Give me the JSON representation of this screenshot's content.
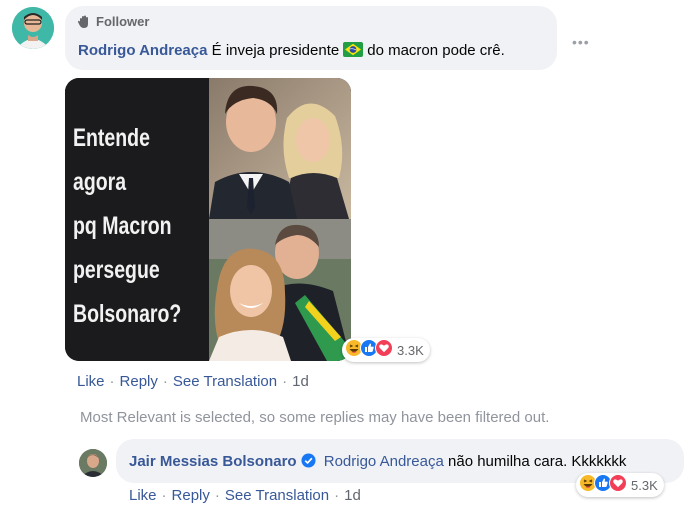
{
  "comment": {
    "badge": "Follower",
    "author": "Rodrigo Andreaça",
    "text_before_flag": "É inveja presidente",
    "text_after_flag": "do macron pode crê.",
    "more_label": "•••",
    "reaction_count": "3.3K",
    "actions": {
      "like": "Like",
      "reply": "Reply",
      "translate": "See Translation",
      "time": "1d"
    }
  },
  "attachment": {
    "meme_text": "Entende\nagora\npq Macron\npersegue\nBolsonaro?"
  },
  "filter_note": "Most Relevant is selected, so some replies may have been filtered out.",
  "reply": {
    "author": "Jair Messias Bolsonaro",
    "mention": "Rodrigo Andreaça",
    "text": "não humilha cara. Kkkkkkk",
    "reaction_count": "5.3K",
    "actions": {
      "like": "Like",
      "reply": "Reply",
      "translate": "See Translation",
      "time": "1d"
    }
  },
  "colors": {
    "link_blue": "#385898",
    "bubble_gray": "#f0f2f5",
    "meta_gray": "#90949c",
    "like_blue": "#1877f2",
    "love_red": "#f33e58",
    "haha_yellow": "#f7b928"
  },
  "icons": {
    "badge": "follower-hand-icon",
    "verified": "verified-check-icon",
    "reactions": [
      "haha-reaction-icon",
      "like-reaction-icon",
      "love-reaction-icon"
    ]
  }
}
